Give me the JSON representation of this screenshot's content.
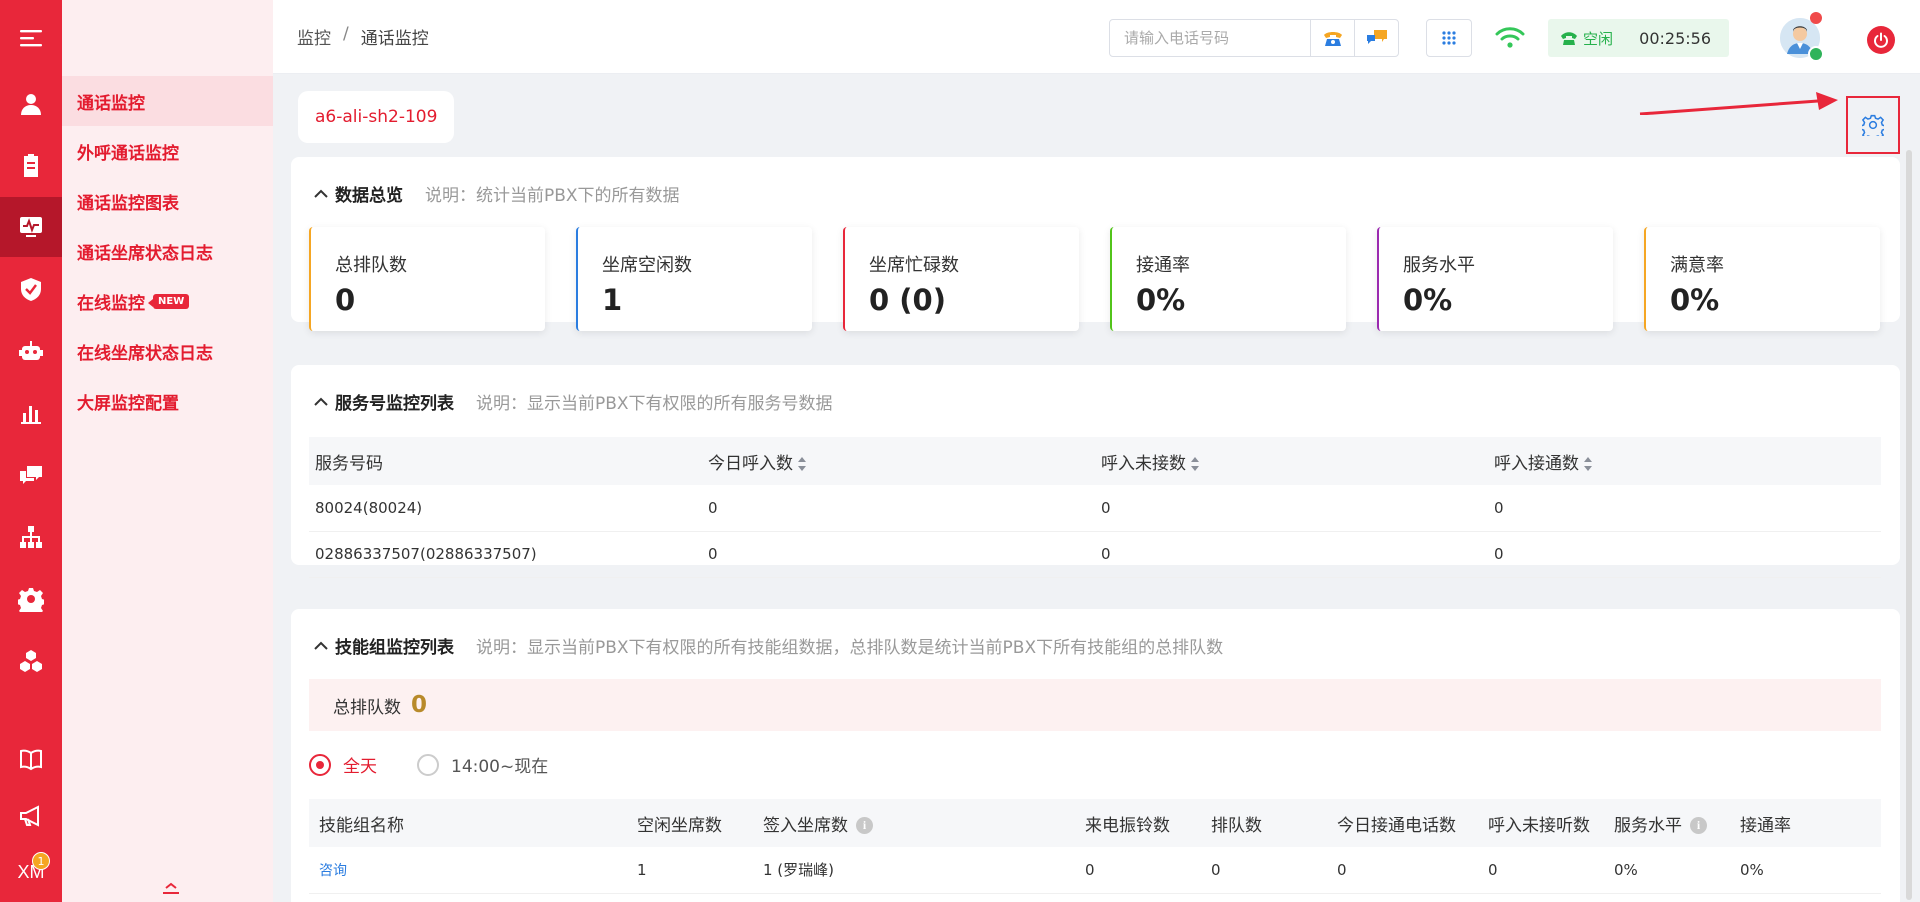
{
  "rail": {
    "items": [
      "user-icon",
      "clipboard-icon",
      "monitor-icon",
      "shield-icon",
      "robot-icon",
      "bar-chart-icon",
      "chat-icon",
      "org-chart-icon",
      "gear-icon",
      "cubes-icon",
      "book-icon",
      "megaphone-icon"
    ],
    "active_index": 2,
    "xm_label": "XM",
    "xm_badge": "1"
  },
  "submenu": {
    "items": [
      {
        "label": "通话监控",
        "active": true
      },
      {
        "label": "外呼通话监控"
      },
      {
        "label": "通话监控图表"
      },
      {
        "label": "通话坐席状态日志"
      },
      {
        "label": "在线监控",
        "badge": "NEW"
      },
      {
        "label": "在线坐席状态日志"
      },
      {
        "label": "大屏监控配置"
      }
    ]
  },
  "topbar": {
    "breadcrumb": [
      "监控",
      "/",
      "通话监控"
    ],
    "phone_placeholder": "请输入电话号码",
    "status_label": "空闲",
    "status_time": "00:25:56"
  },
  "pbx_tab": "a6-ali-sh2-109",
  "overview": {
    "title": "数据总览",
    "desc": "说明：统计当前PBX下的所有数据",
    "stats": [
      {
        "label": "总排队数",
        "value": "0",
        "color": "#f5a623"
      },
      {
        "label": "坐席空闲数",
        "value": "1",
        "color": "#2b7de0"
      },
      {
        "label": "坐席忙碌数",
        "value": "0 (0)",
        "color": "#e8273a"
      },
      {
        "label": "接通率",
        "value": "0%",
        "color": "#52c41a"
      },
      {
        "label": "服务水平",
        "value": "0%",
        "color": "#9b2ab0"
      },
      {
        "label": "满意率",
        "value": "0%",
        "color": "#f5a623"
      }
    ]
  },
  "service": {
    "title": "服务号监控列表",
    "desc": "说明：显示当前PBX下有权限的所有服务号数据",
    "columns": [
      "服务号码",
      "今日呼入数",
      "呼入未接数",
      "呼入接通数"
    ],
    "rows": [
      [
        "80024(80024)",
        "0",
        "0",
        "0"
      ],
      [
        "02886337507(02886337507)",
        "0",
        "0",
        "0"
      ]
    ]
  },
  "skill": {
    "title": "技能组监控列表",
    "desc": "说明：显示当前PBX下有权限的所有技能组数据，总排队数是统计当前PBX下所有技能组的总排队数",
    "queue_label": "总排队数",
    "queue_value": "0",
    "radio_all": "全天",
    "radio_range": "14:00~现在",
    "columns": [
      "技能组名称",
      "空闲坐席数",
      "签入坐席数",
      "来电振铃数",
      "排队数",
      "今日接通电话数",
      "呼入未接听数",
      "服务水平",
      "接通率"
    ],
    "info_glyph": "i",
    "rows": [
      [
        "咨询",
        "1",
        "1 (罗瑞峰)",
        "0",
        "0",
        "0",
        "0",
        "0%",
        "0%"
      ]
    ]
  }
}
